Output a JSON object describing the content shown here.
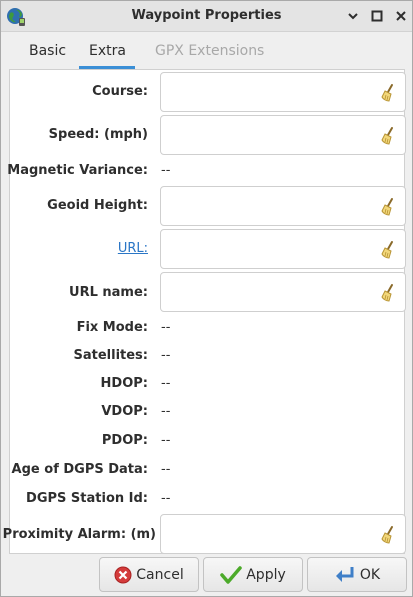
{
  "window": {
    "title": "Waypoint Properties"
  },
  "tabs": [
    {
      "label": "Basic"
    },
    {
      "label": "Extra"
    },
    {
      "label": "GPX Extensions"
    }
  ],
  "fields": {
    "course": {
      "label": "Course:",
      "value": ""
    },
    "speed": {
      "label": "Speed: (mph)",
      "value": ""
    },
    "magnetic_variance": {
      "label": "Magnetic Variance:",
      "value": "--"
    },
    "geoid_height": {
      "label": "Geoid Height:",
      "value": ""
    },
    "url": {
      "label": "URL:",
      "value": ""
    },
    "url_name": {
      "label": "URL name:",
      "value": ""
    },
    "fix_mode": {
      "label": "Fix Mode:",
      "value": "--"
    },
    "satellites": {
      "label": "Satellites:",
      "value": "--"
    },
    "hdop": {
      "label": "HDOP:",
      "value": "--"
    },
    "vdop": {
      "label": "VDOP:",
      "value": "--"
    },
    "pdop": {
      "label": "PDOP:",
      "value": "--"
    },
    "age_dgps": {
      "label": "Age of DGPS Data:",
      "value": "--"
    },
    "dgps_station": {
      "label": "DGPS Station Id:",
      "value": "--"
    },
    "proximity_alarm": {
      "label": "Proximity Alarm: (m)",
      "value": ""
    }
  },
  "buttons": {
    "cancel": "Cancel",
    "apply": "Apply",
    "ok": "OK"
  },
  "icons": {
    "app": "globe-icon",
    "clear": "broom-icon",
    "cancel": "cancel-icon",
    "apply": "checkmark-icon",
    "ok": "ok-arrow-icon"
  },
  "colors": {
    "accent": "#3b8fd6",
    "link": "#2a76c6",
    "disabled_tab": "#a8a8a8"
  }
}
